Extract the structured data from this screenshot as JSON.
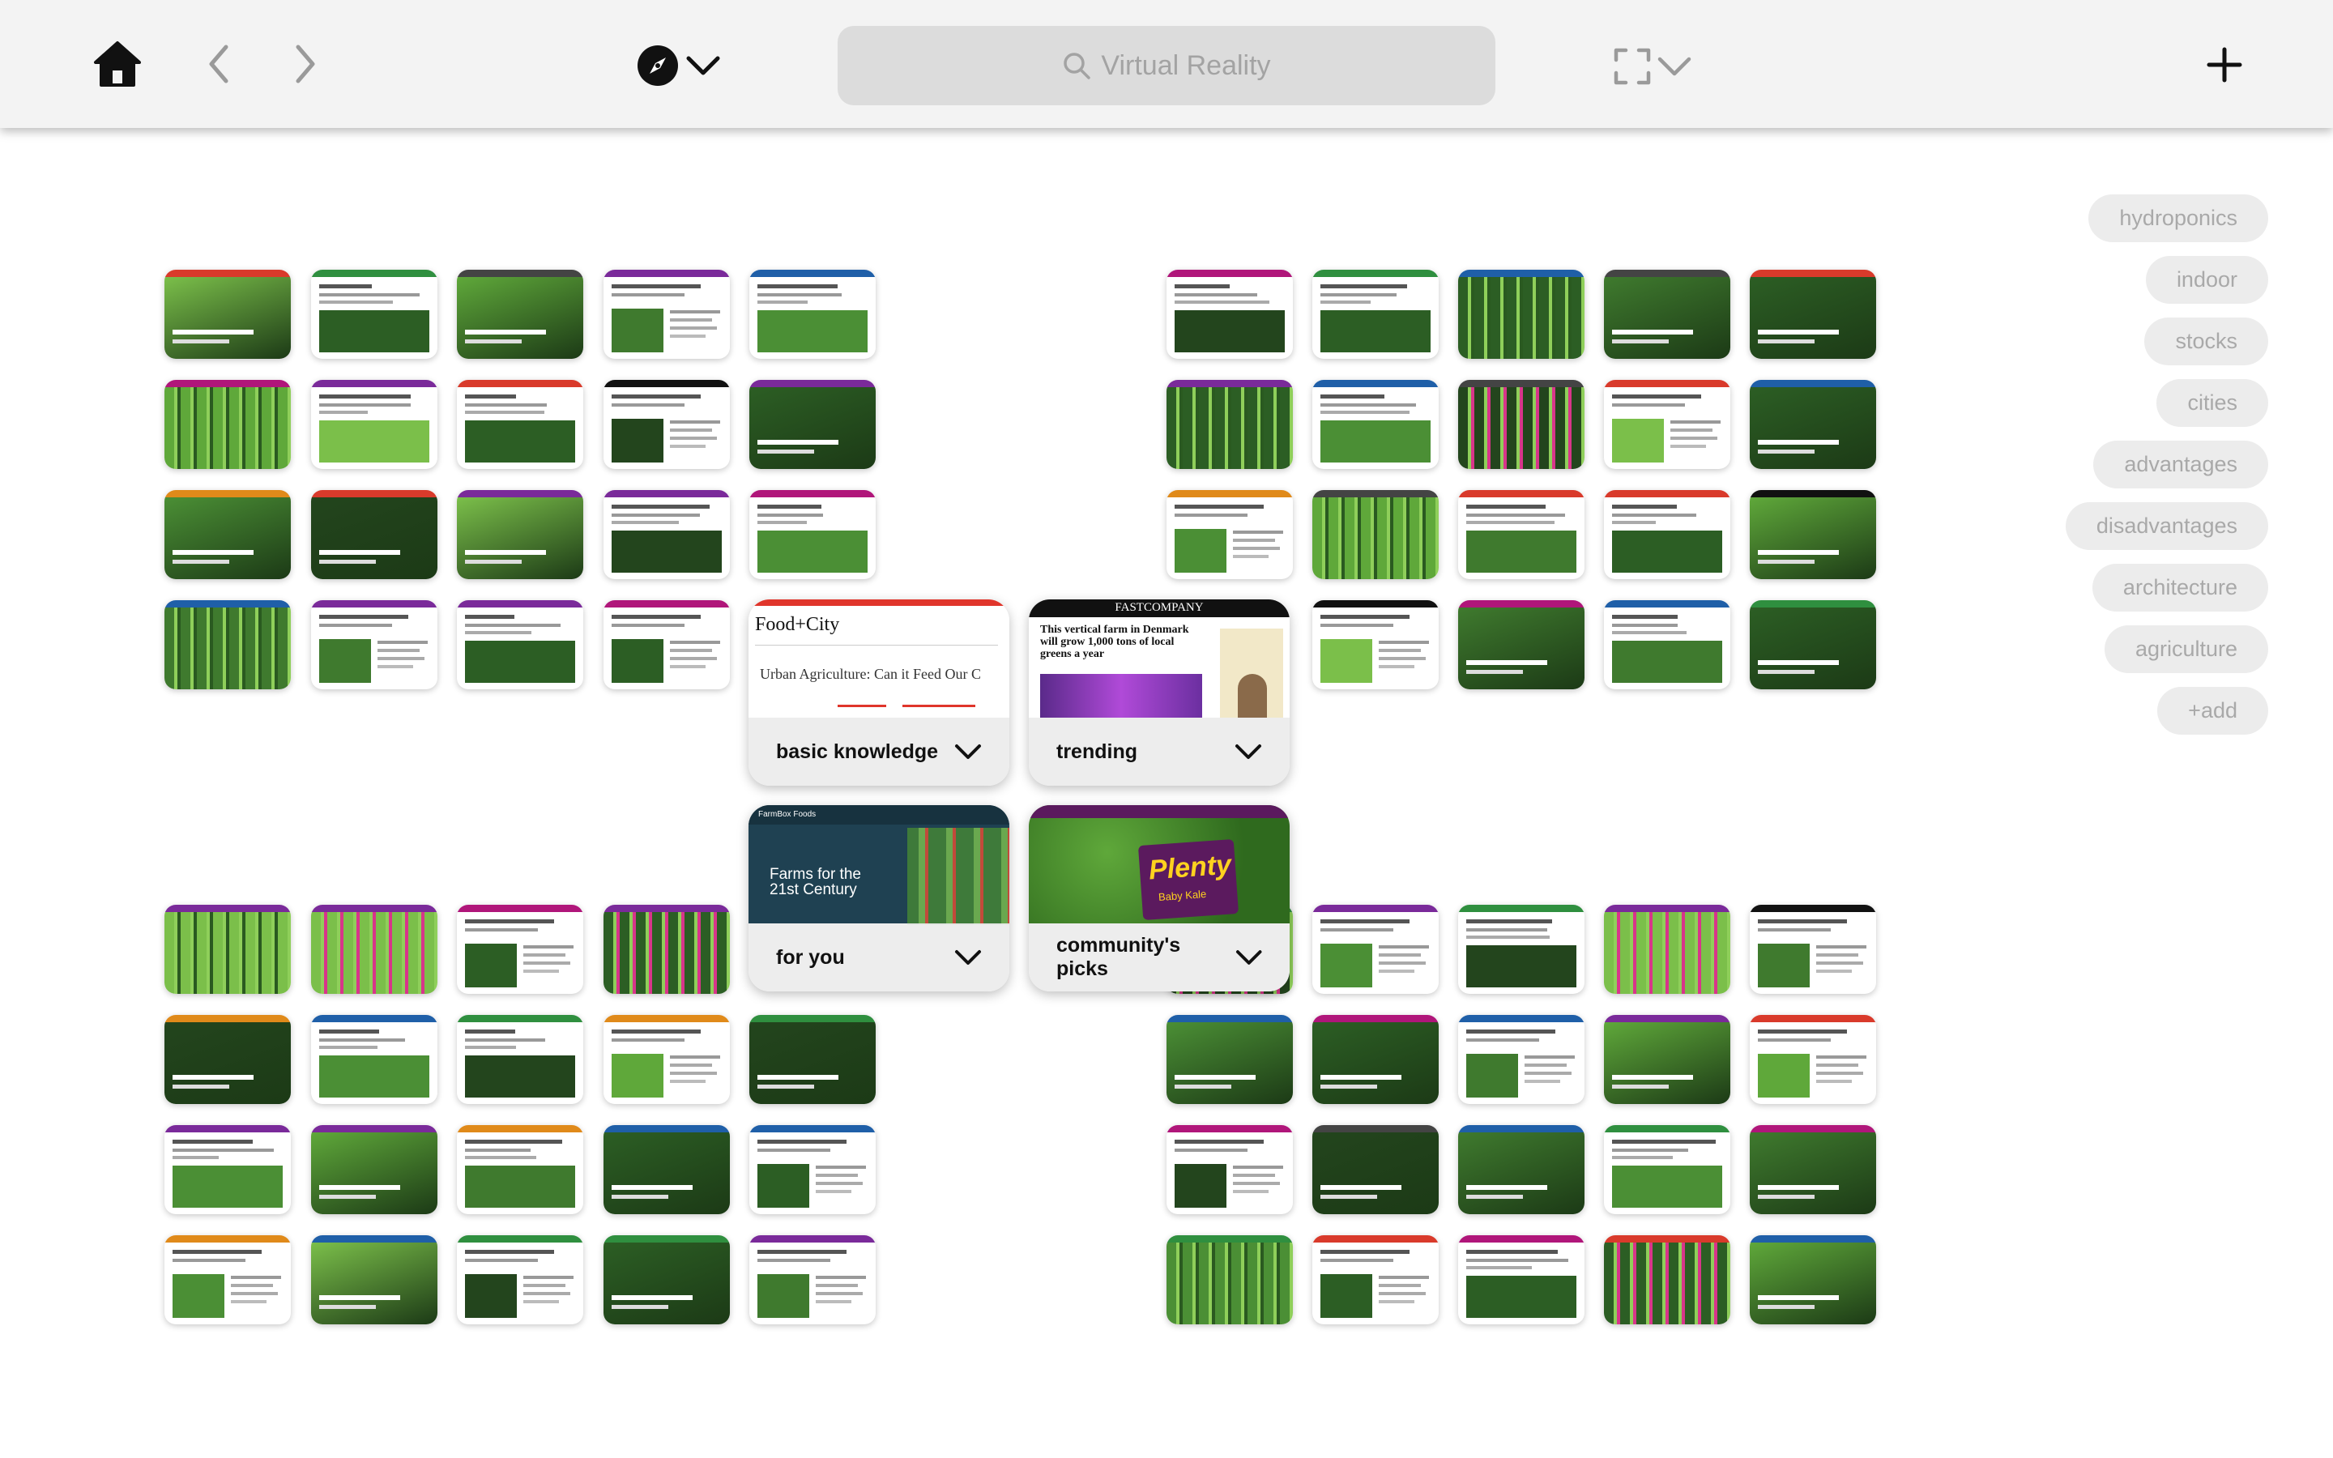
{
  "toolbar": {
    "search_text": "Virtual Reality",
    "home_icon": "home-icon",
    "back_icon": "chevron-left-icon",
    "forward_icon": "chevron-right-icon",
    "compass_icon": "compass-icon",
    "fullscreen_icon": "fullscreen-icon",
    "add_icon": "plus-icon"
  },
  "tags": [
    "hydroponics",
    "indoor",
    "stocks",
    "cities",
    "advantages",
    "disadvantages",
    "architecture",
    "agriculture",
    "+add"
  ],
  "cards": [
    {
      "label": "basic knowledge",
      "preview_title": "Food+City",
      "preview_text": "Urban Agriculture: Can it Feed Our C"
    },
    {
      "label": "trending",
      "preview_title": "FASTCOMPANY",
      "preview_text": "This vertical farm in Denmark will grow 1,000 tons of local greens a year"
    },
    {
      "label": "for you",
      "preview_title": "Farms for the 21st Century",
      "preview_text": "FarmBox Foods"
    },
    {
      "label": "community's picks",
      "preview_title": "Plenty",
      "preview_text": "Baby Kale"
    }
  ]
}
